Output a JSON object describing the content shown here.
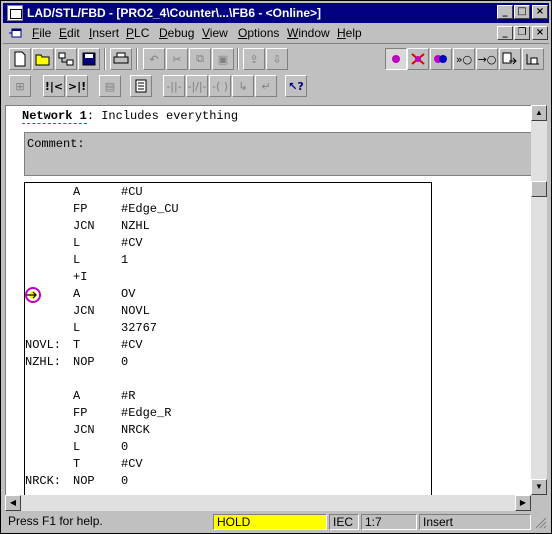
{
  "window": {
    "title": "LAD/STL/FBD  - [PRO2_4\\Counter\\...\\FB6 - <Online>]"
  },
  "menu": [
    "File",
    "Edit",
    "Insert",
    "PLC",
    "Debug",
    "View",
    "Options",
    "Window",
    "Help"
  ],
  "network": {
    "label": "Network 1",
    "title": ": Includes everything",
    "comment_label": "Comment:"
  },
  "code": [
    {
      "label": "",
      "op": "A",
      "arg": "#CU"
    },
    {
      "label": "",
      "op": "FP",
      "arg": "#Edge_CU"
    },
    {
      "label": "",
      "op": "JCN",
      "arg": "NZHL"
    },
    {
      "label": "",
      "op": "L",
      "arg": "#CV"
    },
    {
      "label": "",
      "op": "L",
      "arg": "1"
    },
    {
      "label": "",
      "op": "+I",
      "arg": ""
    },
    {
      "label": "",
      "op": "A",
      "arg": "OV",
      "breakpoint": true
    },
    {
      "label": "",
      "op": "JCN",
      "arg": "NOVL"
    },
    {
      "label": "",
      "op": "L",
      "arg": "32767"
    },
    {
      "label": "NOVL:",
      "op": "T",
      "arg": "#CV"
    },
    {
      "label": "NZHL:",
      "op": "NOP",
      "arg": "0"
    },
    {
      "label": "",
      "op": "",
      "arg": ""
    },
    {
      "label": "",
      "op": "A",
      "arg": "#R"
    },
    {
      "label": "",
      "op": "FP",
      "arg": "#Edge_R"
    },
    {
      "label": "",
      "op": "JCN",
      "arg": "NRCK"
    },
    {
      "label": "",
      "op": "L",
      "arg": "0"
    },
    {
      "label": "",
      "op": "T",
      "arg": "#CV"
    },
    {
      "label": "NRCK:",
      "op": "NOP",
      "arg": "0"
    }
  ],
  "status": {
    "help": "Press F1 for help.",
    "mode": "HOLD",
    "lang": "IEC",
    "position": "1:7",
    "insert": "Insert"
  },
  "colors": {
    "titlebar": "#000080",
    "hold_bg": "#ffff00",
    "breakpoint": "#c000c0"
  }
}
